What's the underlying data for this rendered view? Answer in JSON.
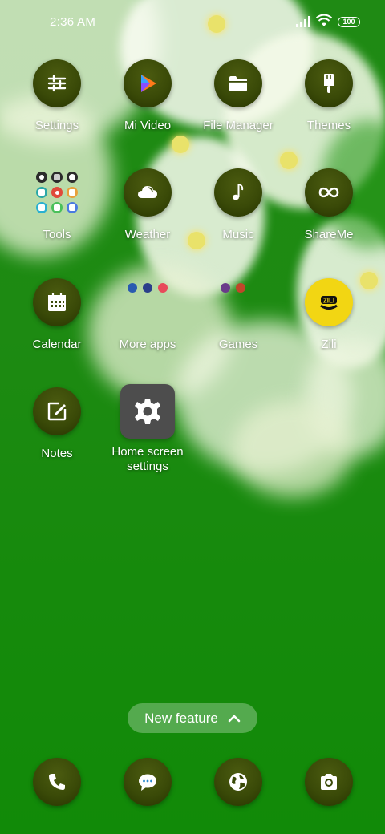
{
  "status_bar": {
    "time": "2:36 AM",
    "battery": "100"
  },
  "apps": [
    {
      "label": "Settings"
    },
    {
      "label": "Mi Video"
    },
    {
      "label": "File Manager"
    },
    {
      "label": "Themes"
    },
    {
      "label": "Tools"
    },
    {
      "label": "Weather"
    },
    {
      "label": "Music"
    },
    {
      "label": "ShareMe"
    },
    {
      "label": "Calendar"
    },
    {
      "label": "More apps"
    },
    {
      "label": "Games"
    },
    {
      "label": "Zili"
    },
    {
      "label": "Notes"
    },
    {
      "label": "Home screen settings"
    }
  ],
  "new_feature": {
    "label": "New feature"
  },
  "dock": {
    "items": [
      "phone-icon",
      "messages-icon",
      "browser-icon",
      "camera-icon"
    ]
  },
  "colors": {
    "icon_bg": "#3a4a08",
    "wallpaper_green": "#1d8a12",
    "pill_bg": "#ffffff47"
  }
}
